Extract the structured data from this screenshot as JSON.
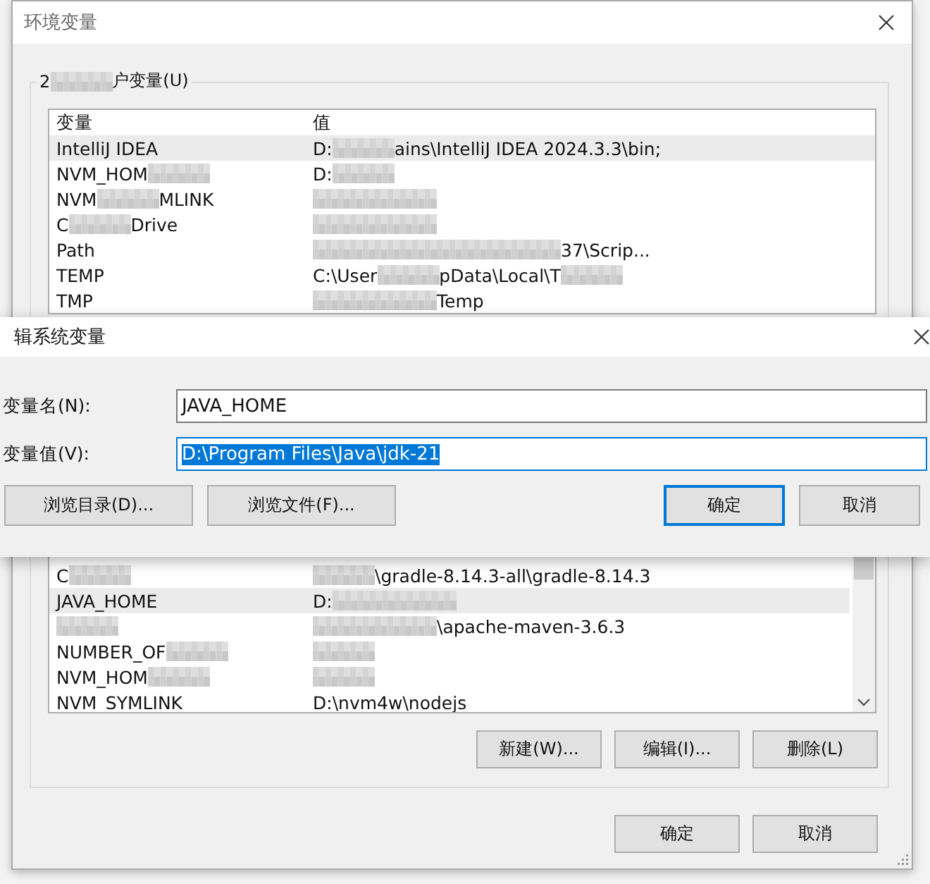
{
  "window": {
    "title": "环境变量"
  },
  "user_group": {
    "title": [
      {
        "kind": "text",
        "text": "2"
      },
      {
        "kind": "blur"
      },
      {
        "kind": "text",
        "text": "户变量(U)"
      }
    ]
  },
  "user_table": {
    "columns": [
      "变量",
      "值"
    ],
    "rows": [
      {
        "selected": true,
        "cells": [
          [
            {
              "kind": "text",
              "text": "IntelliJ IDEA"
            }
          ],
          [
            {
              "kind": "text",
              "text": "D:"
            },
            {
              "kind": "blur"
            },
            {
              "kind": "text",
              "text": "ains\\IntelliJ IDEA 2024.3.3\\bin;"
            }
          ]
        ]
      },
      {
        "selected": false,
        "cells": [
          [
            {
              "kind": "text",
              "text": "NVM_HOM"
            },
            {
              "kind": "blur"
            }
          ],
          [
            {
              "kind": "text",
              "text": "D:"
            },
            {
              "kind": "blur"
            }
          ]
        ]
      },
      {
        "selected": false,
        "cells": [
          [
            {
              "kind": "text",
              "text": "NVM"
            },
            {
              "kind": "blur"
            },
            {
              "kind": "text",
              "text": "MLINK"
            }
          ],
          [
            {
              "kind": "blur"
            },
            {
              "kind": "blur"
            }
          ]
        ]
      },
      {
        "selected": false,
        "cells": [
          [
            {
              "kind": "text",
              "text": "C"
            },
            {
              "kind": "blur"
            },
            {
              "kind": "text",
              "text": "Drive"
            }
          ],
          [
            {
              "kind": "blur"
            },
            {
              "kind": "blur"
            }
          ]
        ]
      },
      {
        "selected": false,
        "cells": [
          [
            {
              "kind": "text",
              "text": "Path"
            }
          ],
          [
            {
              "kind": "blur"
            },
            {
              "kind": "blur"
            },
            {
              "kind": "blur"
            },
            {
              "kind": "blur"
            },
            {
              "kind": "text",
              "text": "37\\Scrip..."
            }
          ]
        ]
      },
      {
        "selected": false,
        "cells": [
          [
            {
              "kind": "text",
              "text": "TEMP"
            }
          ],
          [
            {
              "kind": "text",
              "text": "C:\\User"
            },
            {
              "kind": "blur"
            },
            {
              "kind": "text",
              "text": "pData\\Local\\T"
            },
            {
              "kind": "blur"
            }
          ]
        ]
      },
      {
        "selected": false,
        "cells": [
          [
            {
              "kind": "text",
              "text": "TMP"
            }
          ],
          [
            {
              "kind": "blur"
            },
            {
              "kind": "blur"
            },
            {
              "kind": "text",
              "text": "Temp"
            }
          ]
        ]
      }
    ]
  },
  "system_table": {
    "rows": [
      {
        "selected": false,
        "cells": [
          [
            {
              "kind": "text",
              "text": "C"
            },
            {
              "kind": "blur"
            }
          ],
          [
            {
              "kind": "blur"
            },
            {
              "kind": "text",
              "text": "\\gradle-8.14.3-all\\gradle-8.14.3"
            }
          ]
        ]
      },
      {
        "selected": true,
        "cells": [
          [
            {
              "kind": "text",
              "text": "JAVA_HOME"
            }
          ],
          [
            {
              "kind": "text",
              "text": "D:"
            },
            {
              "kind": "blur"
            },
            {
              "kind": "blur"
            }
          ]
        ]
      },
      {
        "selected": false,
        "cells": [
          [
            {
              "kind": "blur"
            }
          ],
          [
            {
              "kind": "blur"
            },
            {
              "kind": "blur"
            },
            {
              "kind": "text",
              "text": "\\apache-maven-3.6.3"
            }
          ]
        ]
      },
      {
        "selected": false,
        "cells": [
          [
            {
              "kind": "text",
              "text": "NUMBER_OF"
            },
            {
              "kind": "blur"
            }
          ],
          [
            {
              "kind": "blur"
            }
          ]
        ]
      },
      {
        "selected": false,
        "cells": [
          [
            {
              "kind": "text",
              "text": "NVM_HOM"
            },
            {
              "kind": "blur"
            }
          ],
          [
            {
              "kind": "blur"
            }
          ]
        ]
      },
      {
        "selected": false,
        "cells": [
          [
            {
              "kind": "text",
              "text": "NVM_SYMLINK"
            }
          ],
          [
            {
              "kind": "text",
              "text": "D:\\nvm4w\\nodejs"
            }
          ]
        ]
      }
    ]
  },
  "system_buttons": [
    "新建(W)...",
    "编辑(I)...",
    "删除(L)"
  ],
  "footer_buttons": [
    {
      "label": "确定",
      "default": false
    },
    {
      "label": "取消",
      "default": false
    }
  ],
  "dialog": {
    "title": "辑系统变量",
    "fields": [
      {
        "label": "变量名(N):",
        "value": "JAVA_HOME",
        "selected": false
      },
      {
        "label": "变量值(V):",
        "value": "D:\\Program Files\\Java\\jdk-21",
        "selected": true
      }
    ],
    "buttons": [
      {
        "label": "浏览目录(D)...",
        "default": false
      },
      {
        "label": "浏览文件(F)...",
        "default": false
      },
      {
        "label": "确定",
        "default": true
      },
      {
        "label": "取消",
        "default": false
      }
    ]
  }
}
